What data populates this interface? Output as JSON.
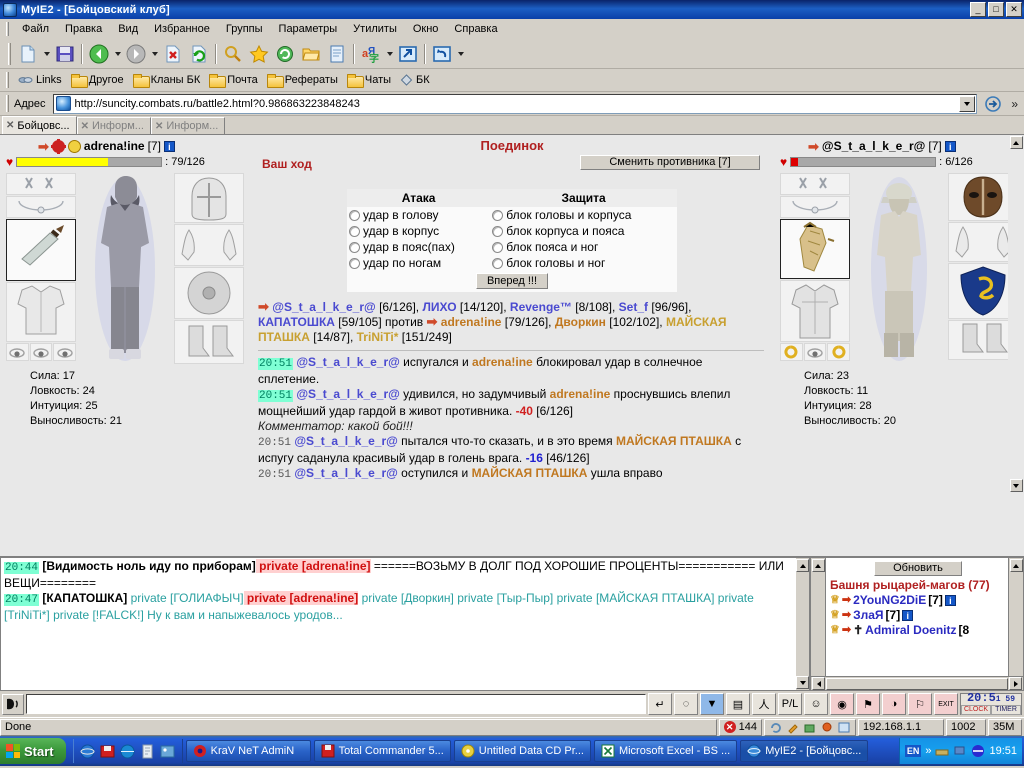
{
  "window": {
    "title": "MyIE2 - [Бойцовский клуб]",
    "icon": "myie2-icon",
    "minimize": "_",
    "maximize": "□",
    "close": "✕"
  },
  "menu": {
    "items": [
      "Файл",
      "Правка",
      "Вид",
      "Избранное",
      "Группы",
      "Параметры",
      "Утилиты",
      "Окно",
      "Справка"
    ]
  },
  "toolbar": {
    "buttons": [
      {
        "name": "new-page-icon",
        "glyph": "page"
      },
      {
        "name": "new-page-dropdown-icon",
        "glyph": "caret"
      },
      {
        "name": "save-icon",
        "glyph": "floppy"
      },
      {
        "name": "back-icon",
        "glyph": "back"
      },
      {
        "name": "back-dropdown-icon",
        "glyph": "caret"
      },
      {
        "name": "forward-icon",
        "glyph": "forward"
      },
      {
        "name": "forward-dropdown-icon",
        "glyph": "caret"
      },
      {
        "name": "stop-icon",
        "glyph": "stop"
      },
      {
        "name": "refresh-icon",
        "glyph": "refresh"
      },
      {
        "name": "search-icon",
        "glyph": "magnifier"
      },
      {
        "name": "favorites-icon",
        "glyph": "star"
      },
      {
        "name": "history-icon",
        "glyph": "history"
      },
      {
        "name": "folder-icon",
        "glyph": "folder"
      },
      {
        "name": "notes-icon",
        "glyph": "notepad"
      },
      {
        "name": "translate-icon",
        "glyph": "translate"
      },
      {
        "name": "translate-dropdown-icon",
        "glyph": "caret"
      },
      {
        "name": "external-icon",
        "glyph": "external"
      },
      {
        "name": "undo-icon",
        "glyph": "undo"
      },
      {
        "name": "undo-dropdown-icon",
        "glyph": "caret"
      }
    ]
  },
  "links_bar": {
    "items": [
      {
        "label": "Links",
        "icon": "link-icon"
      },
      {
        "label": "Другое",
        "icon": "folder-icon"
      },
      {
        "label": "Кланы БК",
        "icon": "folder-icon"
      },
      {
        "label": "Почта",
        "icon": "folder-icon"
      },
      {
        "label": "Рефераты",
        "icon": "folder-icon"
      },
      {
        "label": "Чаты",
        "icon": "folder-icon"
      },
      {
        "label": "БК",
        "icon": "diamond-icon"
      }
    ]
  },
  "address_bar": {
    "label": "Адрес",
    "url": "http://suncity.combats.ru/battle2.html?0.986863223848243",
    "go_icon": "go-icon",
    "chevron": "»"
  },
  "tabs": [
    {
      "label": "Бойцовс...",
      "active": true,
      "icon": "swords-icon"
    },
    {
      "label": "Информ...",
      "active": false,
      "icon": "swords-icon"
    },
    {
      "label": "Информ...",
      "active": false,
      "icon": "swords-icon"
    }
  ],
  "duel": {
    "title": "Поединок",
    "your_turn": "Ваш ход",
    "switch_opponent": "Сменить противника [7]",
    "attack_header": "Атака",
    "defense_header": "Защита",
    "attacks": [
      "удар в голову",
      "удар в корпус",
      "удар в пояс(пах)",
      "удар по ногам"
    ],
    "defenses": [
      "блок головы и корпуса",
      "блок корпуса и пояса",
      "блок пояса и ног",
      "блок головы и ног"
    ],
    "go_button": "Вперед !!!"
  },
  "player_left": {
    "name": "adrena!ine",
    "level": "[7]",
    "info_badge": "i",
    "hp_current": 79,
    "hp_max": 126,
    "hp_text": ": 79/126",
    "hp_percent": 63,
    "hp_color": "#ffff00",
    "stats": [
      {
        "label": "Сила",
        "value": "17"
      },
      {
        "label": "Ловкость",
        "value": "24"
      },
      {
        "label": "Интуиция",
        "value": "25"
      },
      {
        "label": "Выносливость",
        "value": "21"
      }
    ]
  },
  "player_right": {
    "name": "@S_t_a_l_k_e_r@",
    "level": "[7]",
    "info_badge": "i",
    "hp_current": 6,
    "hp_max": 126,
    "hp_text": ": 6/126",
    "hp_percent": 5,
    "hp_color": "#dd0000",
    "stats": [
      {
        "label": "Сила",
        "value": "23"
      },
      {
        "label": "Ловкость",
        "value": "11"
      },
      {
        "label": "Интуиция",
        "value": "28"
      },
      {
        "label": "Выносливость",
        "value": "20"
      }
    ]
  },
  "roster": {
    "team_a": [
      {
        "name": "@S_t_a_l_k_e_r@",
        "hp": "[6/126]",
        "color": "blue"
      },
      {
        "name": "ЛИХО",
        "hp": "[14/120]",
        "color": "blue"
      },
      {
        "name": "Revenge™",
        "hp": "[8/108]",
        "color": "blue"
      },
      {
        "name": "Set_f",
        "hp": "[96/96]",
        "color": "blue"
      },
      {
        "name": "КАПАТОШКА",
        "hp": "[59/105]",
        "color": "blue"
      }
    ],
    "versus": "против",
    "team_b": [
      {
        "name": "adrena!ine",
        "hp": "[79/126]",
        "color": "orange"
      },
      {
        "name": "Дворкин",
        "hp": "[102/102]",
        "color": "orange"
      },
      {
        "name": "МАЙСКАЯ ПТАШКА",
        "hp": "[14/87]",
        "color": "orange"
      },
      {
        "name": "TriNiTi*",
        "hp": "[151/249]",
        "color": "orange"
      }
    ]
  },
  "battle_log": [
    {
      "time": "20:51",
      "time_highlight": true,
      "parts": [
        {
          "t": "@S_t_a_l_k_e_r@",
          "s": "blue"
        },
        {
          "t": " испугался и ",
          "s": "plain"
        },
        {
          "t": "adrena!ine",
          "s": "orange"
        },
        {
          "t": " блокировал удар в солнечное сплетение.",
          "s": "plain"
        }
      ]
    },
    {
      "time": "20:51",
      "time_highlight": true,
      "parts": [
        {
          "t": "@S_t_a_l_k_e_r@",
          "s": "blue"
        },
        {
          "t": " удивился, но задумчивый ",
          "s": "plain"
        },
        {
          "t": "adrena!ine",
          "s": "orange"
        },
        {
          "t": " проснувшись влепил мощнейший удар гардой в живот противника. ",
          "s": "plain"
        },
        {
          "t": "-40",
          "s": "dmg"
        },
        {
          "t": " [6/126]",
          "s": "plain"
        }
      ]
    },
    {
      "time": "",
      "time_highlight": false,
      "parts": [
        {
          "t": "Комментатор: какой бой!!!",
          "s": "comment"
        }
      ]
    },
    {
      "time": "20:51",
      "time_highlight": false,
      "parts": [
        {
          "t": "@S_t_a_l_k_e_r@",
          "s": "blue"
        },
        {
          "t": " пытался что-то сказать, и в это время ",
          "s": "plain"
        },
        {
          "t": "МАЙСКАЯ ПТАШКА",
          "s": "orange"
        },
        {
          "t": " с испугу саданула красивый удар в голень врага. ",
          "s": "plain"
        },
        {
          "t": "-16",
          "s": "dmgblue"
        },
        {
          "t": " [46/126]",
          "s": "plain"
        }
      ]
    },
    {
      "time": "20:51",
      "time_highlight": false,
      "parts": [
        {
          "t": "@S_t_a_l_k_e_r@",
          "s": "blue"
        },
        {
          "t": " оступился и ",
          "s": "plain"
        },
        {
          "t": "МАЙСКАЯ ПТАШКА",
          "s": "orange"
        },
        {
          "t": " ушла вправо",
          "s": "plain"
        }
      ]
    }
  ],
  "chat": {
    "lines": [
      {
        "time": "20:44",
        "parts": [
          {
            "t": "[Видимость ноль иду по приборам]",
            "s": "black"
          },
          {
            "t": " private [adrena!ine]",
            "s": "redbg"
          },
          {
            "t": " ======ВОЗЬМУ В ДОЛГ ПОД ХОРОШИЕ ПРОЦЕНТЫ=========== ИЛИ ВЕЩИ========",
            "s": "plain"
          }
        ]
      },
      {
        "time": "20:47",
        "parts": [
          {
            "t": "[КАПАТОШКА]",
            "s": "black"
          },
          {
            "t": " private [ГОЛИАФЫЧ]",
            "s": "teal"
          },
          {
            "t": " private [adrena!ine]",
            "s": "redbg"
          },
          {
            "t": " private [Дворкин] private [Тыр-Пыр] private [МАЙСКАЯ ПТАШКА] private [TriNiTi*] private [!FALCK!] Ну к вам и напыжевалось уродов...",
            "s": "teal"
          }
        ]
      }
    ]
  },
  "user_panel": {
    "refresh_button": "Обновить",
    "room_title": "Башня рыцарей-магов (77)",
    "users": [
      {
        "name": "2YouNG2DiE",
        "level": "[7]",
        "badge": "i",
        "cross": false
      },
      {
        "name": "ЗлаЯ",
        "level": "[7]",
        "badge": "i",
        "cross": false
      },
      {
        "name": "Admiral Doenitz",
        "level": "[8",
        "badge": "",
        "cross": true
      }
    ]
  },
  "input_bar": {
    "say_icon": "speak-icon",
    "value": "",
    "buttons": [
      {
        "name": "send-button",
        "glyph": "↵"
      },
      {
        "name": "erase-button",
        "glyph": "◌"
      },
      {
        "name": "filter-button",
        "glyph": "▼"
      },
      {
        "name": "save-log-button",
        "glyph": "▤"
      },
      {
        "name": "run-button",
        "glyph": "人"
      },
      {
        "name": "pl-button",
        "glyph": "P/L"
      },
      {
        "name": "smiley-button",
        "glyph": "☺"
      },
      {
        "name": "gold-button",
        "glyph": "◉"
      },
      {
        "name": "flag-button",
        "glyph": "⚑"
      },
      {
        "name": "group-button",
        "glyph": "◑"
      },
      {
        "name": "pennant-button",
        "glyph": "⚐"
      },
      {
        "name": "exit-button",
        "glyph": "EXIT"
      }
    ],
    "clock_time": "20:5",
    "clock_small": "1 59",
    "clock_label": "CLOCK",
    "timer_label": "TIMER"
  },
  "status_bar": {
    "text": "Done",
    "error_count": "144",
    "ip": "192.168.1.1",
    "port": "1002",
    "mem": "35M",
    "icons": [
      "refresh-status-icon",
      "brush-icon",
      "net-icon",
      "settings-icon",
      "edit-icon"
    ]
  },
  "taskbar": {
    "start": "Start",
    "quick_launch": [
      "ie-icon",
      "floppy-icon",
      "globe-icon",
      "doc-icon",
      "picture-icon"
    ],
    "tasks": [
      {
        "label": "KraV NeT AdmiN",
        "icon": "krav-icon",
        "active": false
      },
      {
        "label": "Total Commander 5...",
        "icon": "tc-icon",
        "active": false
      },
      {
        "label": "Untitled Data CD Pr...",
        "icon": "nero-icon",
        "active": false
      },
      {
        "label": "Microsoft Excel - BS ...",
        "icon": "excel-icon",
        "active": false
      },
      {
        "label": "MyIE2 - [Бойцовс...",
        "icon": "myie2-icon",
        "active": true
      }
    ],
    "tray": {
      "lang": "EN",
      "chevron": "»",
      "icons": [
        "modem-icon",
        "network-icon",
        "volume-icon"
      ],
      "clock": "19:51"
    }
  }
}
